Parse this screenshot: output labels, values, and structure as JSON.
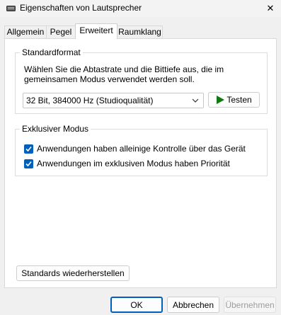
{
  "window": {
    "title": "Eigenschaften von Lautsprecher",
    "close_glyph": "✕",
    "icon": "speaker-device-icon"
  },
  "tabs": [
    {
      "label": "Allgemein",
      "active": false
    },
    {
      "label": "Pegel",
      "active": false
    },
    {
      "label": "Erweitert",
      "active": true
    },
    {
      "label": "Raumklang",
      "active": false
    }
  ],
  "standardformat": {
    "legend": "Standardformat",
    "description": "Wählen Sie die Abtastrate und die Bittiefe aus, die im gemeinsamen Modus verwendet werden soll.",
    "selected_format": "32 Bit, 384000 Hz (Studioqualität)",
    "test_button_label": "Testen",
    "play_icon_color": "#0f7b0f"
  },
  "exklusiv": {
    "legend": "Exklusiver Modus",
    "options": [
      {
        "label": "Anwendungen haben alleinige Kontrolle über das Gerät",
        "checked": true
      },
      {
        "label": "Anwendungen im exklusiven Modus haben Priorität",
        "checked": true
      }
    ]
  },
  "restore_defaults_label": "Standards wiederherstellen",
  "footer": {
    "ok_label": "OK",
    "cancel_label": "Abbrechen",
    "apply_label": "Übernehmen"
  },
  "colors": {
    "accent": "#005fb8"
  }
}
